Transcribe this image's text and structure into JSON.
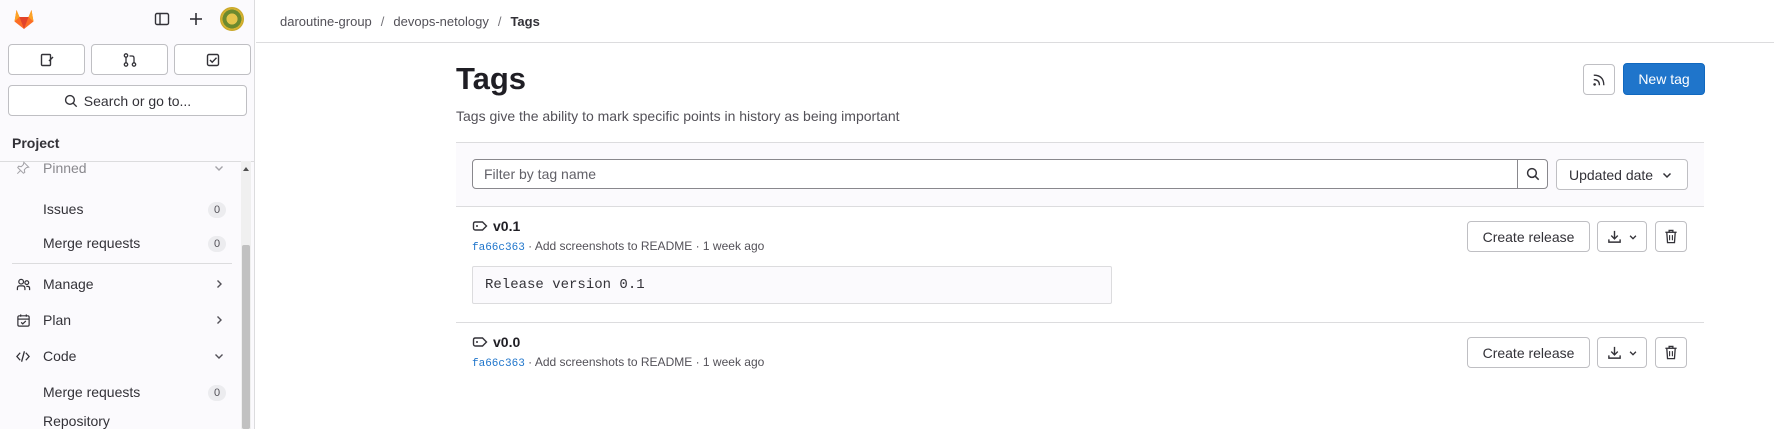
{
  "sidebar": {
    "search_label": "Search or go to...",
    "section_title": "Project",
    "items": [
      {
        "label": "Pinned"
      },
      {
        "label": "Issues",
        "count": "0"
      },
      {
        "label": "Merge requests",
        "count": "0"
      },
      {
        "label": "Manage"
      },
      {
        "label": "Plan"
      },
      {
        "label": "Code"
      },
      {
        "label": "Merge requests",
        "count": "0"
      },
      {
        "label": "Repository"
      }
    ]
  },
  "breadcrumb": {
    "group": "daroutine-group",
    "project": "devops-netology",
    "current": "Tags"
  },
  "page": {
    "title": "Tags",
    "description": "Tags give the ability to mark specific points in history as being important",
    "new_tag_label": "New tag"
  },
  "filter": {
    "placeholder": "Filter by tag name",
    "sort_label": "Updated date"
  },
  "tags": [
    {
      "name": "v0.1",
      "sha": "fa66c363",
      "commit_message": "Add screenshots to README",
      "time": "1 week ago",
      "message": "Release version 0.1",
      "create_release_label": "Create release"
    },
    {
      "name": "v0.0",
      "sha": "fa66c363",
      "commit_message": "Add screenshots to README",
      "time": "1 week ago",
      "create_release_label": "Create release"
    }
  ],
  "colors": {
    "primary": "#1f75cb",
    "sidebar_bg": "#fbfafd",
    "border": "#dcdcde",
    "text": "#333238",
    "logo_orange": "#fc6d26",
    "logo_red": "#e24329"
  }
}
